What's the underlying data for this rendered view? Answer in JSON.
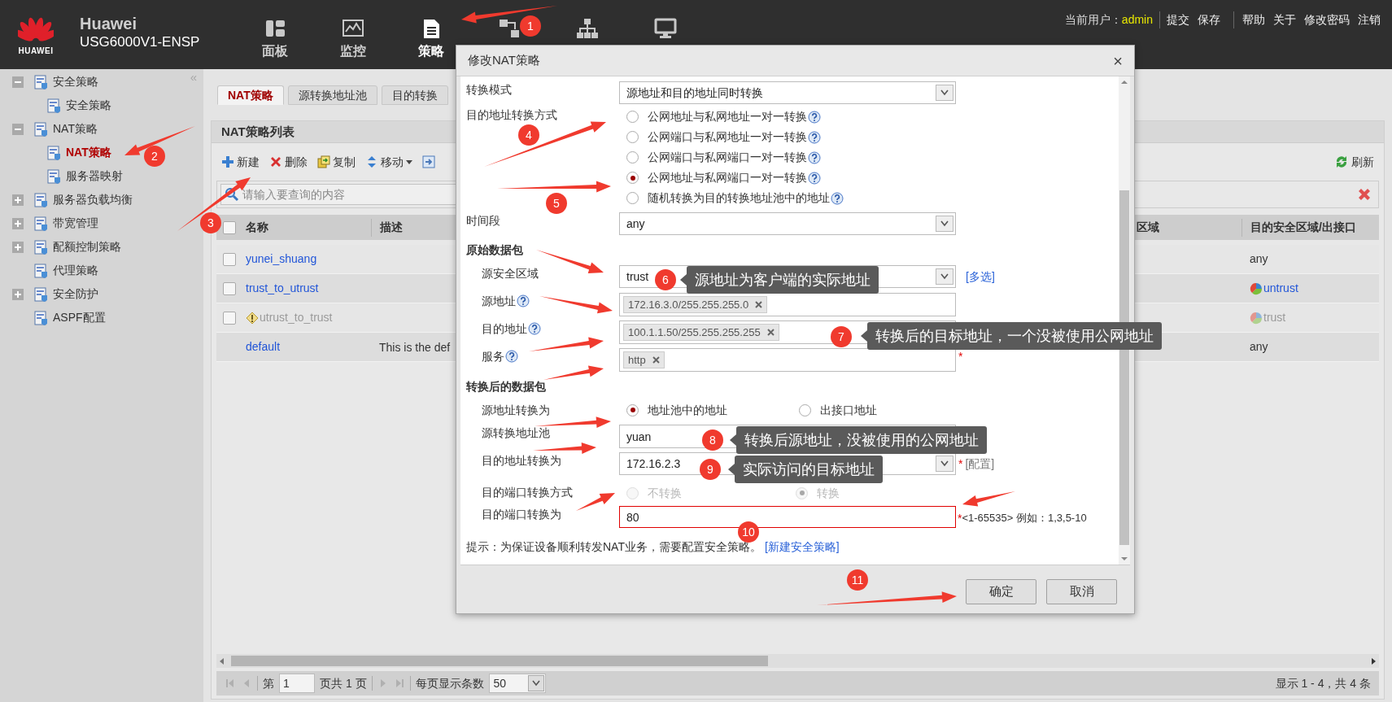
{
  "header": {
    "logo_text": "HUAWEI",
    "brand": "Huawei",
    "model": "USG6000V1-ENSP",
    "nav": [
      {
        "label": "面板",
        "selected": false
      },
      {
        "label": "监控",
        "selected": false
      },
      {
        "label": "策略",
        "selected": true
      },
      {
        "selected": false
      },
      {
        "selected": false
      },
      {
        "selected": false
      }
    ],
    "user_label": "当前用户：",
    "user": "admin",
    "actions_primary": [
      "提交",
      "保存"
    ],
    "actions_secondary": [
      "帮助",
      "关于",
      "修改密码",
      "注销"
    ]
  },
  "sidebar": {
    "collapse": "«",
    "items": [
      {
        "label": "安全策略",
        "expanded": true,
        "selected": false,
        "children": [
          {
            "label": "安全策略",
            "selected": false
          }
        ]
      },
      {
        "label": "NAT策略",
        "expanded": true,
        "selected": false,
        "children": [
          {
            "label": "NAT策略",
            "selected": true
          },
          {
            "label": "服务器映射",
            "selected": false
          }
        ]
      },
      {
        "label": "服务器负载均衡",
        "expanded": false,
        "selected": false
      },
      {
        "label": "带宽管理",
        "expanded": false,
        "selected": false
      },
      {
        "label": "配额控制策略",
        "expanded": false,
        "selected": false
      },
      {
        "label": "代理策略",
        "selected": false
      },
      {
        "label": "安全防护",
        "expanded": false,
        "selected": false
      },
      {
        "label": "ASPF配置",
        "selected": false
      }
    ]
  },
  "tabs": [
    {
      "label": "NAT策略",
      "selected": true
    },
    {
      "label": "源转换地址池",
      "selected": false
    },
    {
      "label": "目的转换",
      "selected": false
    }
  ],
  "panel": {
    "title": "NAT策略列表",
    "toolbar": [
      {
        "label": "新建",
        "dropdown": false
      },
      {
        "label": "删除",
        "dropdown": false
      },
      {
        "label": "复制",
        "dropdown": false
      },
      {
        "label": "移动",
        "dropdown": true
      },
      {
        "dropdown": false
      }
    ],
    "refresh": "刷新",
    "search": {
      "placeholder": "请输入要查询的内容"
    },
    "table": {
      "select_all_checked": false,
      "columns": [
        "名称",
        "描述",
        "区域",
        "目的安全区域/出接口"
      ],
      "rows": [
        {
          "checked": false,
          "disabled": false,
          "name": "yunei_shuang",
          "destination": {
            "kind": "text",
            "text": "any"
          }
        },
        {
          "checked": false,
          "disabled": false,
          "name": "trust_to_utrust",
          "destination": {
            "kind": "zone",
            "text": "untrust"
          }
        },
        {
          "checked": false,
          "disabled": true,
          "name": "utrust_to_trust",
          "destination": {
            "kind": "zone",
            "text": "trust"
          }
        },
        {
          "disabled": false,
          "name": "default",
          "description": "This is the def",
          "destination": {
            "kind": "text",
            "text": "any"
          }
        }
      ]
    },
    "pager": {
      "page_label": "第",
      "page": "1",
      "total_label": "页共 1 页",
      "per_page_label": "每页显示条数",
      "per_page": "50",
      "summary": "显示 1 - 4，共 4 条"
    }
  },
  "dialog": {
    "title": "修改NAT策略",
    "close": "×",
    "mode": {
      "label": "转换模式",
      "value": "源地址和目的地址同时转换"
    },
    "dest_method": {
      "label": "目的地址转换方式",
      "options": [
        {
          "label": "公网地址与私网地址一对一转换",
          "selected": false
        },
        {
          "label": "公网端口与私网地址一对一转换",
          "selected": false
        },
        {
          "label": "公网端口与私网端口一对一转换",
          "selected": false
        },
        {
          "label": "公网地址与私网端口一对一转换",
          "selected": true
        },
        {
          "label": "随机转换为目的转换地址池中的地址",
          "selected": false
        }
      ]
    },
    "time": {
      "label": "时间段",
      "value": "any"
    },
    "original_heading": "原始数据包",
    "src_zone": {
      "label": "源安全区域",
      "value": "trust",
      "link": "[多选]"
    },
    "src_addr": {
      "label": "源地址",
      "tokens": [
        "172.16.3.0/255.255.255.0"
      ]
    },
    "dst_addr": {
      "label": "目的地址",
      "tokens": [
        "100.1.1.50/255.255.255.255"
      ]
    },
    "service": {
      "label": "服务",
      "tokens": [
        "http"
      ],
      "required": "*"
    },
    "translated_heading": "转换后的数据包",
    "src_translate": {
      "label": "源地址转换为",
      "options": [
        {
          "label": "地址池中的地址",
          "selected": true
        },
        {
          "label": "出接口地址",
          "selected": false
        }
      ]
    },
    "src_pool": {
      "label": "源转换地址池",
      "value": "yuan"
    },
    "dst_translate": {
      "label": "目的地址转换为",
      "value": "172.16.2.3",
      "required": "*",
      "link": "[配置]"
    },
    "port_method": {
      "label": "目的端口转换方式",
      "disabled": true,
      "options": [
        {
          "label": "不转换",
          "selected": false
        },
        {
          "label": "转换",
          "selected": true
        }
      ]
    },
    "port": {
      "label": "目的端口转换为",
      "value": "80",
      "invalid": true,
      "required": "*",
      "hint": "<1-65535> 例如：1,3,5-10"
    },
    "tip": "提示：为保证设备顺利转发NAT业务，需要配置安全策略。",
    "tip_link": "[新建安全策略]",
    "buttons": [
      "确定",
      "取消"
    ]
  },
  "annotations": {
    "markers": [
      "1",
      "2",
      "3",
      "4",
      "5",
      "6",
      "7",
      "8",
      "9",
      "10",
      "11"
    ],
    "callouts": [
      "源地址为客户端的实际地址",
      "转换后的目标地址，一个没被使用公网地址",
      "转换后源地址，没被使用的公网地址",
      "实际访问的目标地址"
    ]
  }
}
